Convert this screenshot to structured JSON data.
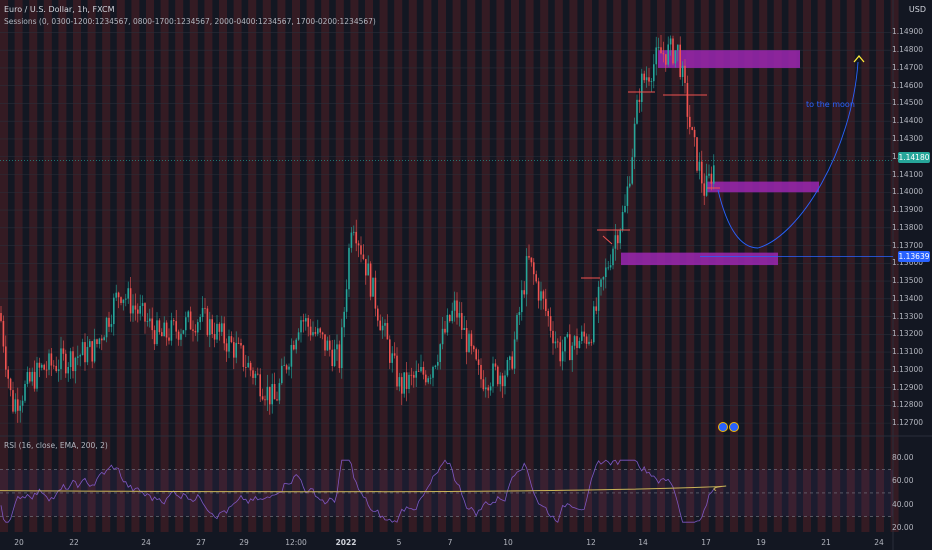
{
  "symbol_legend": "Euro / U.S. Dollar, 1h, FXCM",
  "sessions_legend": "Sessions (0, 0300-1200:1234567, 0800-1700:1234567, 2000-0400:1234567, 1700-0200:1234567)",
  "rsi_legend": "RSI (16, close, EMA, 200, 2)",
  "currency": "USD",
  "annotation_text": "to the moon",
  "last_price": "1.14180",
  "line_price": "1.13639",
  "colors": {
    "background": "#131722",
    "up": "#26a69a",
    "down": "#ef5350",
    "session_band": "#3b1c23",
    "zone": "#9c27b0",
    "rsi_line": "#7e57c2",
    "rsi_ema": "#c9b458",
    "annotation": "#2962ff"
  },
  "price_axis": [
    "1.14900",
    "1.14800",
    "1.14700",
    "1.14600",
    "1.14500",
    "1.14400",
    "1.14300",
    "1.14200",
    "1.14100",
    "1.14000",
    "1.13900",
    "1.13800",
    "1.13700",
    "1.13600",
    "1.13500",
    "1.13400",
    "1.13300",
    "1.13200",
    "1.13100",
    "1.13000",
    "1.12900",
    "1.12800",
    "1.12700"
  ],
  "rsi_axis": [
    "80.00",
    "60.00",
    "40.00",
    "20.00"
  ],
  "time_axis": [
    {
      "label": "20",
      "bold": false
    },
    {
      "label": "22",
      "bold": false
    },
    {
      "label": "24",
      "bold": false
    },
    {
      "label": "27",
      "bold": false
    },
    {
      "label": "29",
      "bold": false
    },
    {
      "label": "12:00",
      "bold": false
    },
    {
      "label": "2022",
      "bold": true
    },
    {
      "label": "5",
      "bold": false
    },
    {
      "label": "7",
      "bold": false
    },
    {
      "label": "10",
      "bold": false
    },
    {
      "label": "12",
      "bold": false
    },
    {
      "label": "14",
      "bold": false
    },
    {
      "label": "17",
      "bold": false
    },
    {
      "label": "19",
      "bold": false
    },
    {
      "label": "21",
      "bold": false
    },
    {
      "label": "24",
      "bold": false
    }
  ],
  "chart_data": {
    "type": "candlestick",
    "price_range": [
      1.1265,
      1.1497
    ],
    "rsi_range": [
      20,
      85
    ],
    "rsi_levels": [
      70,
      50,
      30
    ],
    "zones": [
      {
        "from": 1.148,
        "to": 1.147
      },
      {
        "from": 1.1406,
        "to": 1.14
      },
      {
        "from": 1.1366,
        "to": 1.1359
      }
    ],
    "horizontal_line": 1.13639,
    "last_close": 1.1418
  }
}
